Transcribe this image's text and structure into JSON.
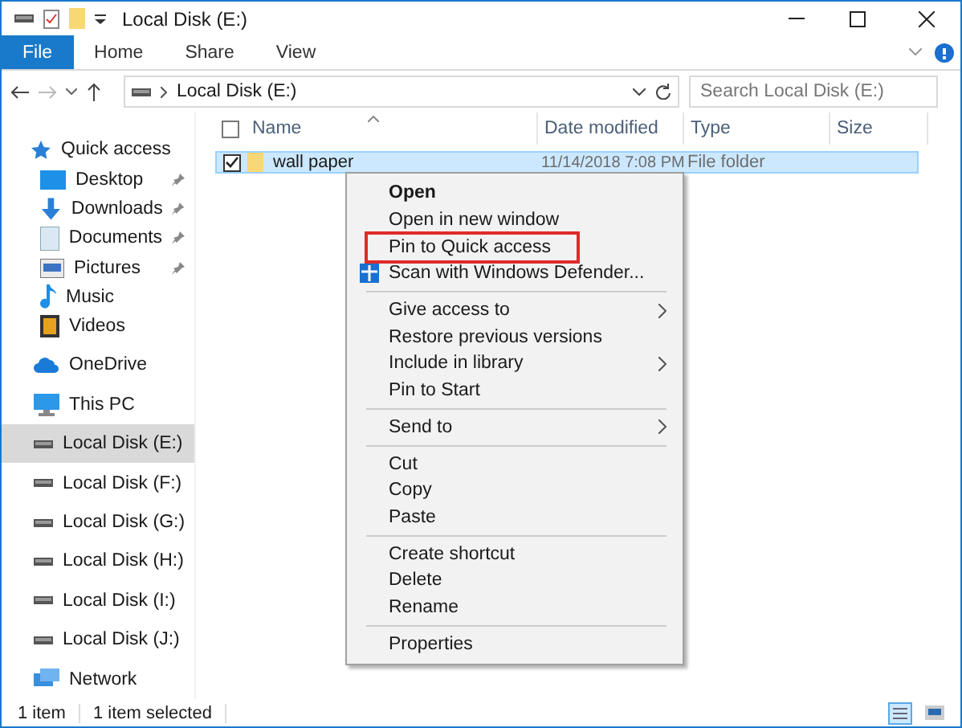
{
  "window": {
    "title": "Local Disk (E:)"
  },
  "ribbon_tabs": [
    {
      "label": "File",
      "selected": true
    },
    {
      "label": "Home",
      "selected": false
    },
    {
      "label": "Share",
      "selected": false
    },
    {
      "label": "View",
      "selected": false
    }
  ],
  "address": {
    "path": "Local Disk (E:)"
  },
  "search": {
    "placeholder": "Search Local Disk (E:)"
  },
  "sidebar": {
    "items": [
      {
        "label": "Quick access",
        "selected": false,
        "children": [
          {
            "label": "Desktop",
            "pinned": true,
            "selected": false
          },
          {
            "label": "Downloads",
            "pinned": true,
            "selected": false
          },
          {
            "label": "Documents",
            "pinned": true,
            "selected": false
          },
          {
            "label": "Pictures",
            "pinned": true,
            "selected": false
          },
          {
            "label": "Music",
            "pinned": false,
            "selected": false
          },
          {
            "label": "Videos",
            "pinned": false,
            "selected": false
          }
        ]
      },
      {
        "label": "OneDrive",
        "selected": false
      },
      {
        "label": "This PC",
        "selected": false
      },
      {
        "label": "Local Disk (E:)",
        "selected": true
      },
      {
        "label": "Local Disk (F:)",
        "selected": false
      },
      {
        "label": "Local Disk (G:)",
        "selected": false
      },
      {
        "label": "Local Disk (H:)",
        "selected": false
      },
      {
        "label": "Local Disk (I:)",
        "selected": false
      },
      {
        "label": "Local Disk (J:)",
        "selected": false
      },
      {
        "label": "Network",
        "selected": false
      }
    ]
  },
  "table": {
    "select_all_checked": false,
    "columns": [
      "Name",
      "Date modified",
      "Type",
      "Size"
    ],
    "rows": [
      {
        "name": "wall paper",
        "date_modified": "11/14/2018 7:08 PM",
        "type": "File folder",
        "checked": true,
        "selected": true
      }
    ]
  },
  "context_menu": {
    "items": [
      {
        "kind": "item",
        "label": "Open",
        "default": true,
        "submenu": false,
        "highlighted": false
      },
      {
        "kind": "item",
        "label": "Open in new window",
        "default": false,
        "submenu": false,
        "highlighted": false
      },
      {
        "kind": "item",
        "label": "Pin to Quick access",
        "default": false,
        "submenu": false,
        "highlighted": true
      },
      {
        "kind": "item",
        "label": "Scan with Windows Defender...",
        "default": false,
        "submenu": false,
        "highlighted": false,
        "shield": true
      },
      {
        "kind": "separator"
      },
      {
        "kind": "item",
        "label": "Give access to",
        "default": false,
        "submenu": true,
        "highlighted": false
      },
      {
        "kind": "item",
        "label": "Restore previous versions",
        "default": false,
        "submenu": false,
        "highlighted": false
      },
      {
        "kind": "item",
        "label": "Include in library",
        "default": false,
        "submenu": true,
        "highlighted": false
      },
      {
        "kind": "item",
        "label": "Pin to Start",
        "default": false,
        "submenu": false,
        "highlighted": false
      },
      {
        "kind": "separator"
      },
      {
        "kind": "item",
        "label": "Send to",
        "default": false,
        "submenu": true,
        "highlighted": false
      },
      {
        "kind": "separator"
      },
      {
        "kind": "item",
        "label": "Cut",
        "default": false,
        "submenu": false,
        "highlighted": false
      },
      {
        "kind": "item",
        "label": "Copy",
        "default": false,
        "submenu": false,
        "highlighted": false
      },
      {
        "kind": "item",
        "label": "Paste",
        "default": false,
        "submenu": false,
        "highlighted": false
      },
      {
        "kind": "separator"
      },
      {
        "kind": "item",
        "label": "Create shortcut",
        "default": false,
        "submenu": false,
        "highlighted": false
      },
      {
        "kind": "item",
        "label": "Delete",
        "default": false,
        "submenu": false,
        "highlighted": false
      },
      {
        "kind": "item",
        "label": "Rename",
        "default": false,
        "submenu": false,
        "highlighted": false
      },
      {
        "kind": "separator"
      },
      {
        "kind": "item",
        "label": "Properties",
        "default": false,
        "submenu": false,
        "highlighted": false
      }
    ]
  },
  "status_bar": {
    "item_count": "1 item",
    "selection": "1 item selected"
  }
}
